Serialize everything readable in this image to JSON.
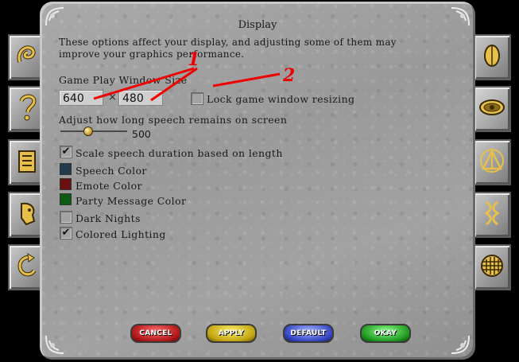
{
  "dialog": {
    "title": "Display",
    "description": "These options affect your display, and adjusting some of them may improve your graphics performance."
  },
  "window_size": {
    "label": "Game Play Window Size",
    "width": "640",
    "separator": "×",
    "height": "480",
    "lock_label": "Lock game window resizing",
    "lock_checked": false
  },
  "speech": {
    "label": "Adjust how long speech remains on screen",
    "value": "500",
    "slider_fraction": 0.4
  },
  "options": {
    "scale_speech": {
      "label": "Scale speech duration based on length",
      "checked": true,
      "mark": "✔"
    },
    "speech_color": {
      "label": "Speech Color",
      "color": "#233a4a"
    },
    "emote_color": {
      "label": "Emote Color",
      "color": "#6a1010"
    },
    "party_color": {
      "label": "Party Message Color",
      "color": "#0f5a12"
    },
    "dark_nights": {
      "label": "Dark Nights",
      "checked": false
    },
    "colored_lighting": {
      "label": "Colored Lighting",
      "checked": true,
      "mark": "✔"
    }
  },
  "buttons": {
    "cancel": "CANCEL",
    "apply": "APPLY",
    "default": "DEFAULT",
    "okay": "OKAY"
  },
  "annotations": {
    "one": "1",
    "two": "2",
    "color": "#e00000"
  },
  "tabs": {
    "left": [
      "swirl-icon",
      "question-mark-icon",
      "book-icon",
      "face-icon",
      "refresh-arrow-icon"
    ],
    "right": [
      "pouch-icon",
      "eye-icon",
      "triangle-icon",
      "figure-icon",
      "grid-icon"
    ]
  }
}
